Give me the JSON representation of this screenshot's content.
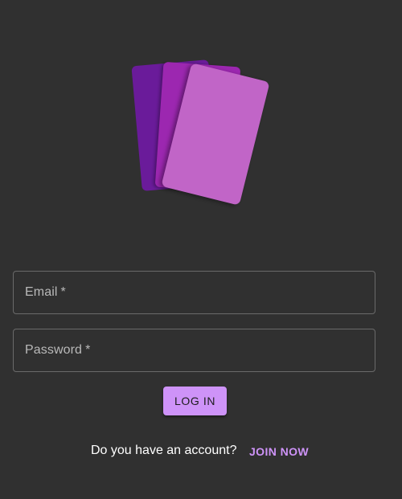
{
  "colors": {
    "background": "#303030",
    "accent": "#ce93f8",
    "card_back": "#6a1b9a",
    "card_middle": "#9c27b0",
    "card_front": "#ba68c8",
    "field_border": "#6a6a6a"
  },
  "logo": {
    "icon": "stacked-cards-icon"
  },
  "form": {
    "email": {
      "label": "Email",
      "required_mark": "*",
      "value": ""
    },
    "password": {
      "label": "Password",
      "required_mark": "*",
      "value": ""
    },
    "login_label": "LOG IN"
  },
  "signup": {
    "prompt": "Do you have an account?",
    "link_label": "JOIN NOW"
  }
}
